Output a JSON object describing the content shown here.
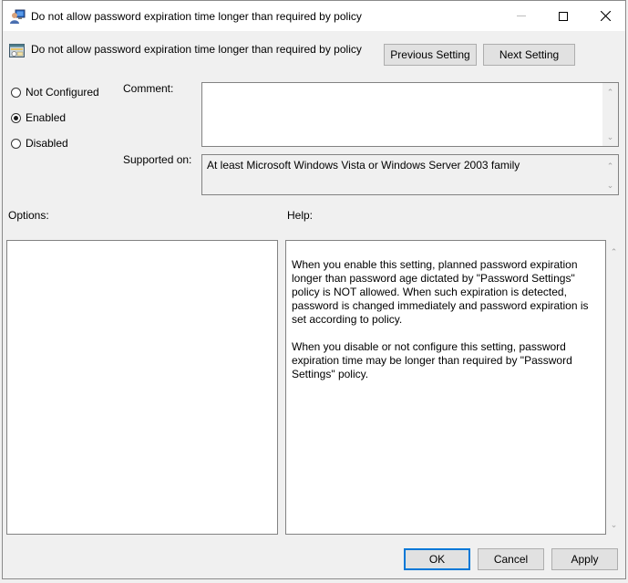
{
  "window": {
    "title": "Do not allow password expiration time longer than required by policy",
    "title_icon": "policy-editor-icon",
    "controls": {
      "minimize": "minimize-icon",
      "maximize": "maximize-icon",
      "close": "close-icon"
    }
  },
  "header": {
    "setting_name": "Do not allow password expiration time longer than required by policy",
    "setting_icon": "setting-icon",
    "previous_label": "Previous Setting",
    "next_label": "Next Setting"
  },
  "state": {
    "options": [
      {
        "label": "Not Configured",
        "checked": false
      },
      {
        "label": "Enabled",
        "checked": true
      },
      {
        "label": "Disabled",
        "checked": false
      }
    ]
  },
  "comment": {
    "label": "Comment:",
    "value": ""
  },
  "supported": {
    "label": "Supported on:",
    "value": "At least Microsoft Windows Vista or Windows Server 2003 family"
  },
  "options_panel": {
    "label": "Options:"
  },
  "help_panel": {
    "label": "Help:",
    "paragraphs": [
      "When you enable this setting, planned password expiration longer than password age dictated by \"Password Settings\" policy is NOT allowed. When such expiration is detected, password is changed immediately and password expiration is set according to policy.",
      "When you disable or not configure this setting, password expiration time may be longer than required by \"Password Settings\" policy."
    ]
  },
  "footer": {
    "ok_label": "OK",
    "cancel_label": "Cancel",
    "apply_label": "Apply"
  }
}
